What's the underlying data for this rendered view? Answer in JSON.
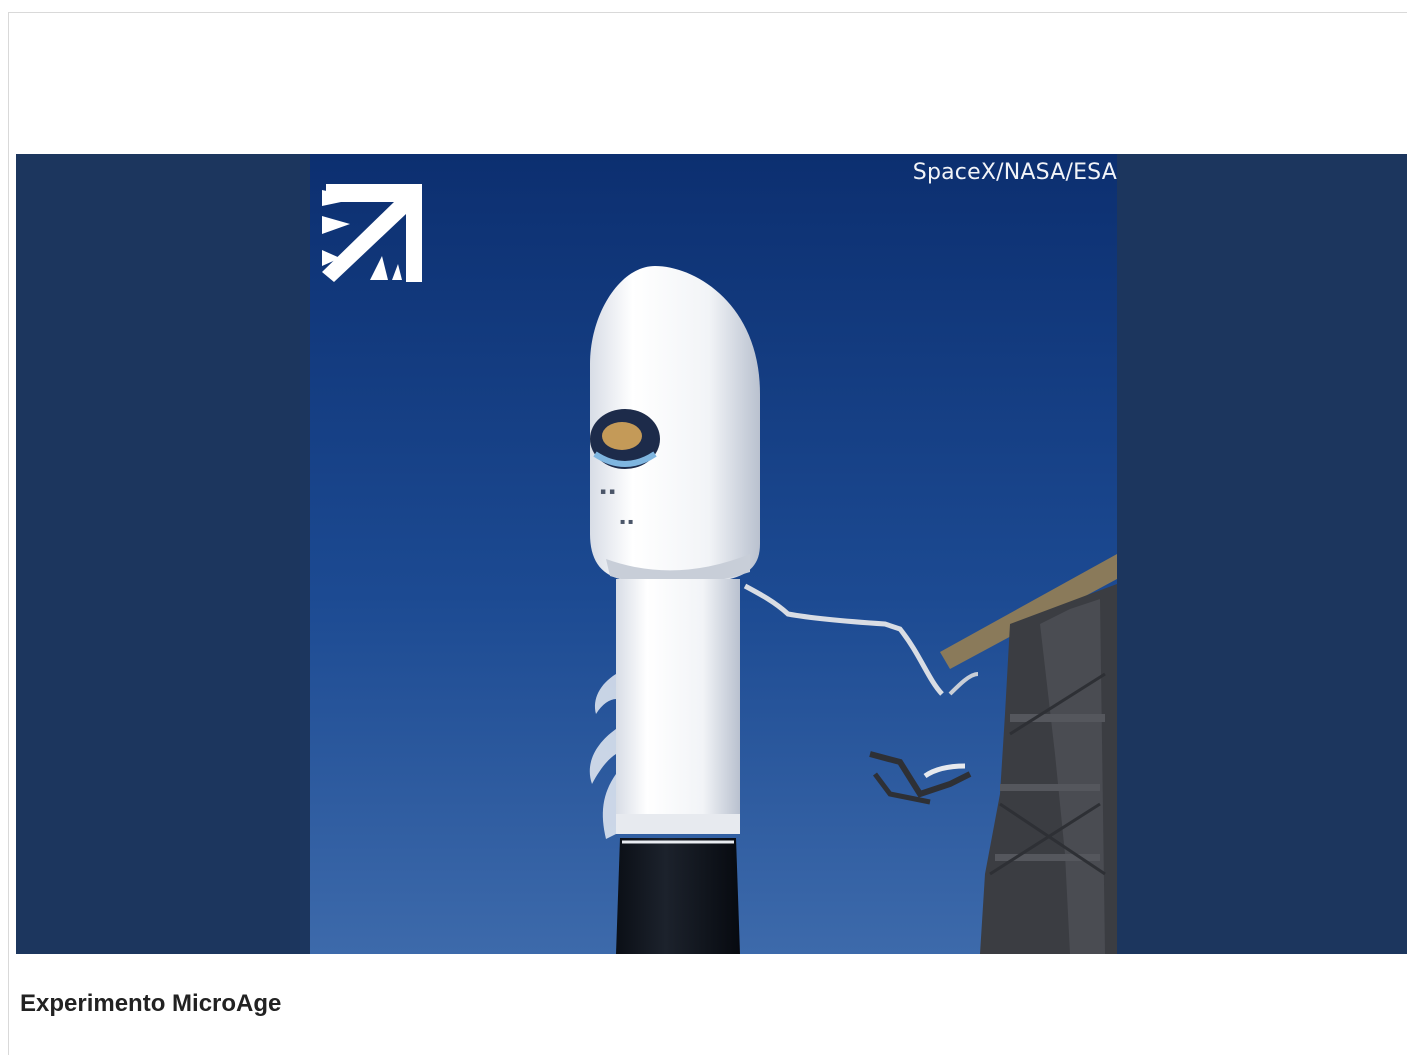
{
  "media": {
    "credit": "SpaceX/NASA/ESA",
    "logo": "arrow-burst-logo-icon",
    "subject": "rocket-fairing"
  },
  "caption": {
    "title": "Experimento MicroAge"
  },
  "colors": {
    "side_panel": "#1c365e",
    "sky_top": "#0f3477",
    "sky_bottom": "#3a66a8",
    "caption_text": "#222222"
  }
}
